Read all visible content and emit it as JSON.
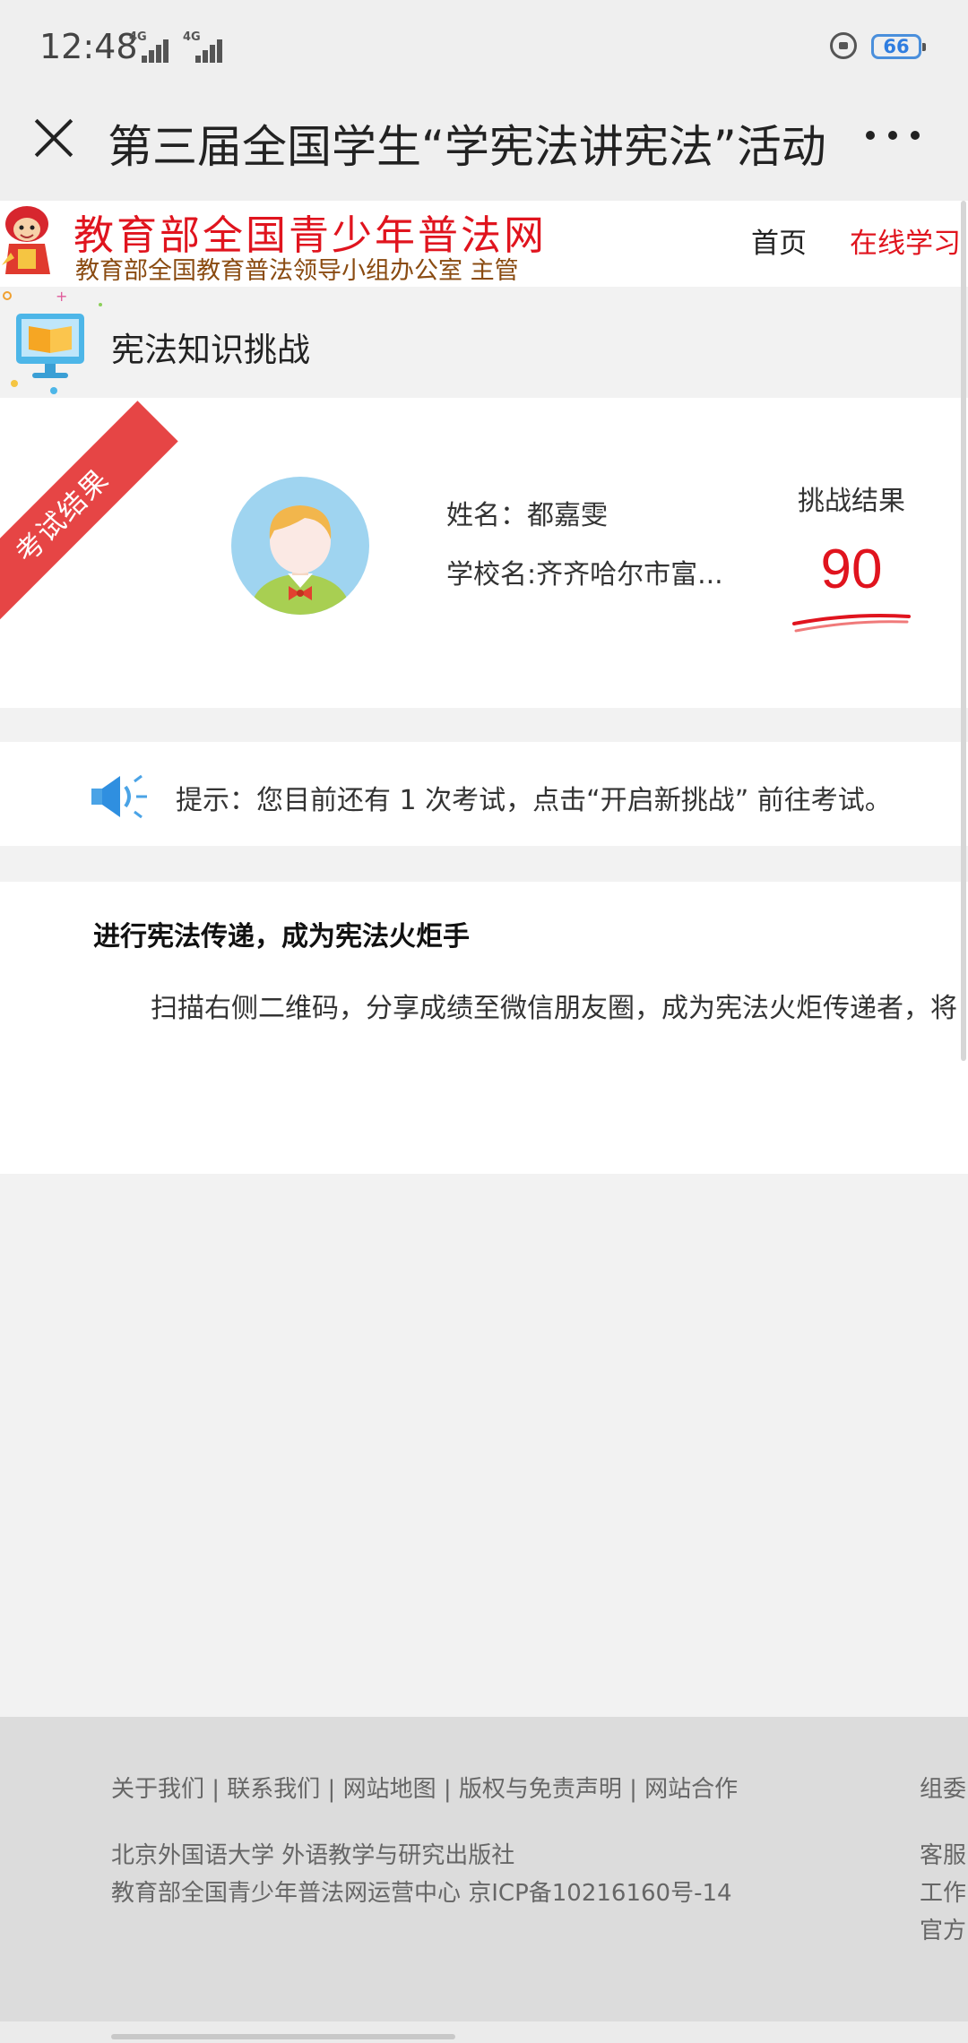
{
  "status_bar": {
    "time": "12:48",
    "network1": "4G",
    "network2": "4G",
    "battery": "66"
  },
  "nav": {
    "title": "第三届全国学生“学宪法讲宪法”活动"
  },
  "site": {
    "name": "教育部全国青少年普法网",
    "subtitle": "教育部全国教育普法领导小组办公室 主管",
    "nav_home": "首页",
    "nav_study": "在线学习"
  },
  "section": {
    "title": "宪法知识挑战"
  },
  "result": {
    "ribbon": "考试结果",
    "name_label": "姓名：都嘉雯",
    "school_label": "学校名:齐齐哈尔市富...",
    "score_label": "挑战结果",
    "score": "90"
  },
  "tip": {
    "text": "提示：您目前还有 1 次考试，点击“开启新挑战” 前往考试。"
  },
  "torch": {
    "title": "进行宪法传递，成为宪法火炬手",
    "text": "扫描右侧二维码，分享成绩至微信朋友圈，成为宪法火炬传递者，将"
  },
  "footer": {
    "links": "关于我们 | 联系我们 | 网站地图 | 版权与免责声明 | 网站合作",
    "line2": "北京外国语大学 外语教学与研究出版社",
    "line3": "教育部全国青少年普法网运营中心 京ICP备10216160号-14",
    "right1": "组委",
    "right2": "客服",
    "right3": "工作",
    "right4": "官方"
  },
  "colors": {
    "accent_red": "#e0141e",
    "subtitle_brown": "#8a4b11",
    "ribbon_red": "#e64545",
    "battery_blue": "#2f7de0",
    "footer_bg": "#dcdcdc"
  },
  "icons": [
    "close-icon",
    "more-icon",
    "lock-icon",
    "battery-icon",
    "monitor-book-icon",
    "student-avatar",
    "speaker-icon",
    "mascot-logo"
  ]
}
